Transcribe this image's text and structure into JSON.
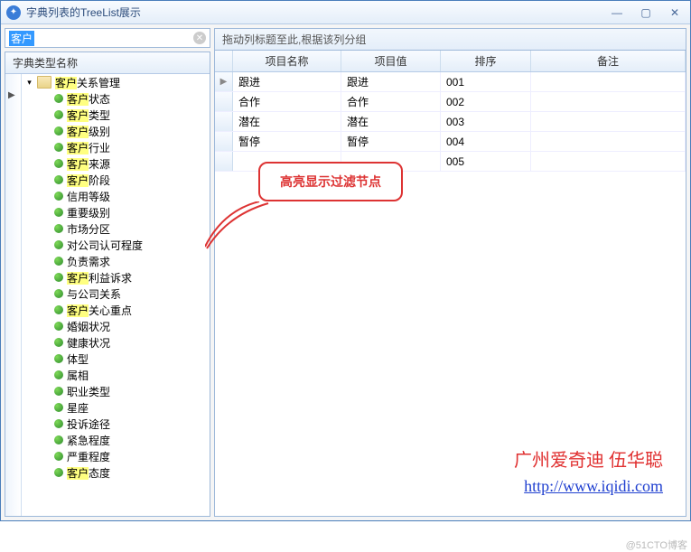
{
  "window": {
    "title": "字典列表的TreeList展示"
  },
  "search": {
    "value": "客户"
  },
  "tree": {
    "header": "字典类型名称",
    "root": {
      "label_pre": "",
      "label_hl": "客户",
      "label_post": "关系管理"
    },
    "items": [
      {
        "pre": "",
        "hl": "客户",
        "post": "状态"
      },
      {
        "pre": "",
        "hl": "客户",
        "post": "类型"
      },
      {
        "pre": "",
        "hl": "客户",
        "post": "级别"
      },
      {
        "pre": "",
        "hl": "客户",
        "post": "行业"
      },
      {
        "pre": "",
        "hl": "客户",
        "post": "来源"
      },
      {
        "pre": "",
        "hl": "客户",
        "post": "阶段"
      },
      {
        "pre": "信用等级",
        "hl": "",
        "post": ""
      },
      {
        "pre": "重要级别",
        "hl": "",
        "post": ""
      },
      {
        "pre": "市场分区",
        "hl": "",
        "post": ""
      },
      {
        "pre": "对公司认可程度",
        "hl": "",
        "post": ""
      },
      {
        "pre": "负责需求",
        "hl": "",
        "post": ""
      },
      {
        "pre": "",
        "hl": "客户",
        "post": "利益诉求"
      },
      {
        "pre": "与公司关系",
        "hl": "",
        "post": ""
      },
      {
        "pre": "",
        "hl": "客户",
        "post": "关心重点"
      },
      {
        "pre": "婚姻状况",
        "hl": "",
        "post": ""
      },
      {
        "pre": "健康状况",
        "hl": "",
        "post": ""
      },
      {
        "pre": "体型",
        "hl": "",
        "post": ""
      },
      {
        "pre": "属相",
        "hl": "",
        "post": ""
      },
      {
        "pre": "职业类型",
        "hl": "",
        "post": ""
      },
      {
        "pre": "星座",
        "hl": "",
        "post": ""
      },
      {
        "pre": "投诉途径",
        "hl": "",
        "post": ""
      },
      {
        "pre": "紧急程度",
        "hl": "",
        "post": ""
      },
      {
        "pre": "严重程度",
        "hl": "",
        "post": ""
      },
      {
        "pre": "",
        "hl": "客户",
        "post": "态度"
      }
    ]
  },
  "grid": {
    "group_hint": "拖动列标题至此,根据该列分组",
    "columns": [
      "项目名称",
      "项目值",
      "排序",
      "备注"
    ],
    "rows": [
      {
        "name": "跟进",
        "value": "跟进",
        "order": "001",
        "note": ""
      },
      {
        "name": "合作",
        "value": "合作",
        "order": "002",
        "note": ""
      },
      {
        "name": "潜在",
        "value": "潜在",
        "order": "003",
        "note": ""
      },
      {
        "name": "暂停",
        "value": "暂停",
        "order": "004",
        "note": ""
      },
      {
        "name": "",
        "value": "",
        "order": "005",
        "note": ""
      }
    ]
  },
  "callout": {
    "text": "高亮显示过滤节点"
  },
  "watermark": {
    "line1": "广州爱奇迪 伍华聪",
    "url": "http://www.iqidi.com"
  },
  "footer": "@51CTO博客"
}
